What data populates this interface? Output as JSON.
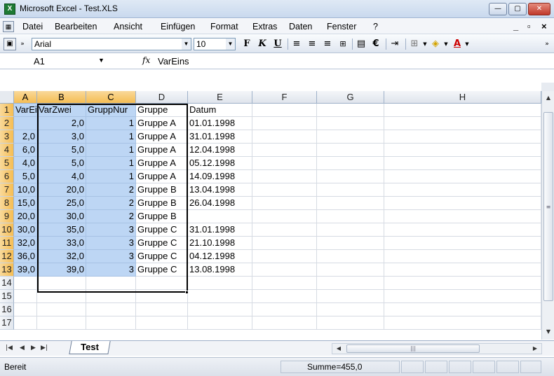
{
  "window": {
    "title": "Microsoft Excel - Test.XLS"
  },
  "menu": {
    "items": [
      "Datei",
      "Bearbeiten",
      "Ansicht",
      "Einfügen",
      "Format",
      "Extras",
      "Daten",
      "Fenster",
      "?"
    ]
  },
  "toolbar": {
    "font_name": "Arial",
    "font_size": "10",
    "bold": "F",
    "italic": "K",
    "underline": "U",
    "euro": "€",
    "font_color": "A"
  },
  "formula_bar": {
    "name_box": "A1",
    "fx": "fx",
    "value": "VarEins"
  },
  "columns": [
    "A",
    "B",
    "C",
    "D",
    "E",
    "F",
    "G",
    "H"
  ],
  "rows": [
    [
      "VarEins",
      "VarZwei",
      "GruppNur",
      "Gruppe",
      "Datum"
    ],
    [
      "",
      "2,0",
      "1",
      "Gruppe A",
      "01.01.1998"
    ],
    [
      "2,0",
      "3,0",
      "1",
      "Gruppe A",
      "31.01.1998"
    ],
    [
      "6,0",
      "5,0",
      "1",
      "Gruppe A",
      "12.04.1998"
    ],
    [
      "4,0",
      "5,0",
      "1",
      "Gruppe A",
      "05.12.1998"
    ],
    [
      "5,0",
      "4,0",
      "1",
      "Gruppe A",
      "14.09.1998"
    ],
    [
      "10,0",
      "20,0",
      "2",
      "Gruppe B",
      "13.04.1998"
    ],
    [
      "15,0",
      "25,0",
      "2",
      "Gruppe B",
      "26.04.1998"
    ],
    [
      "20,0",
      "30,0",
      "2",
      "Gruppe B",
      ""
    ],
    [
      "30,0",
      "35,0",
      "3",
      "Gruppe C",
      "31.01.1998"
    ],
    [
      "32,0",
      "33,0",
      "3",
      "Gruppe C",
      "21.10.1998"
    ],
    [
      "36,0",
      "32,0",
      "3",
      "Gruppe C",
      "04.12.1998"
    ],
    [
      "39,0",
      "39,0",
      "3",
      "Gruppe C",
      "13.08.1998"
    ],
    [
      "",
      "",
      "",
      "",
      ""
    ],
    [
      "",
      "",
      "",
      "",
      ""
    ],
    [
      "",
      "",
      "",
      "",
      ""
    ],
    [
      "",
      "",
      "",
      "",
      ""
    ]
  ],
  "row_numbers": [
    "1",
    "2",
    "3",
    "4",
    "5",
    "6",
    "7",
    "8",
    "9",
    "10",
    "11",
    "12",
    "13",
    "14",
    "15",
    "16",
    "17"
  ],
  "selected": {
    "columns": [
      "A",
      "B",
      "C"
    ],
    "row_count": 13
  },
  "sheet_tabs": [
    "Test"
  ],
  "status": {
    "text": "Bereit",
    "sum": "Summe=455,0"
  },
  "colors": {
    "selection_fill": "#bdd6f4",
    "header_highlight": "#f5bd53"
  }
}
